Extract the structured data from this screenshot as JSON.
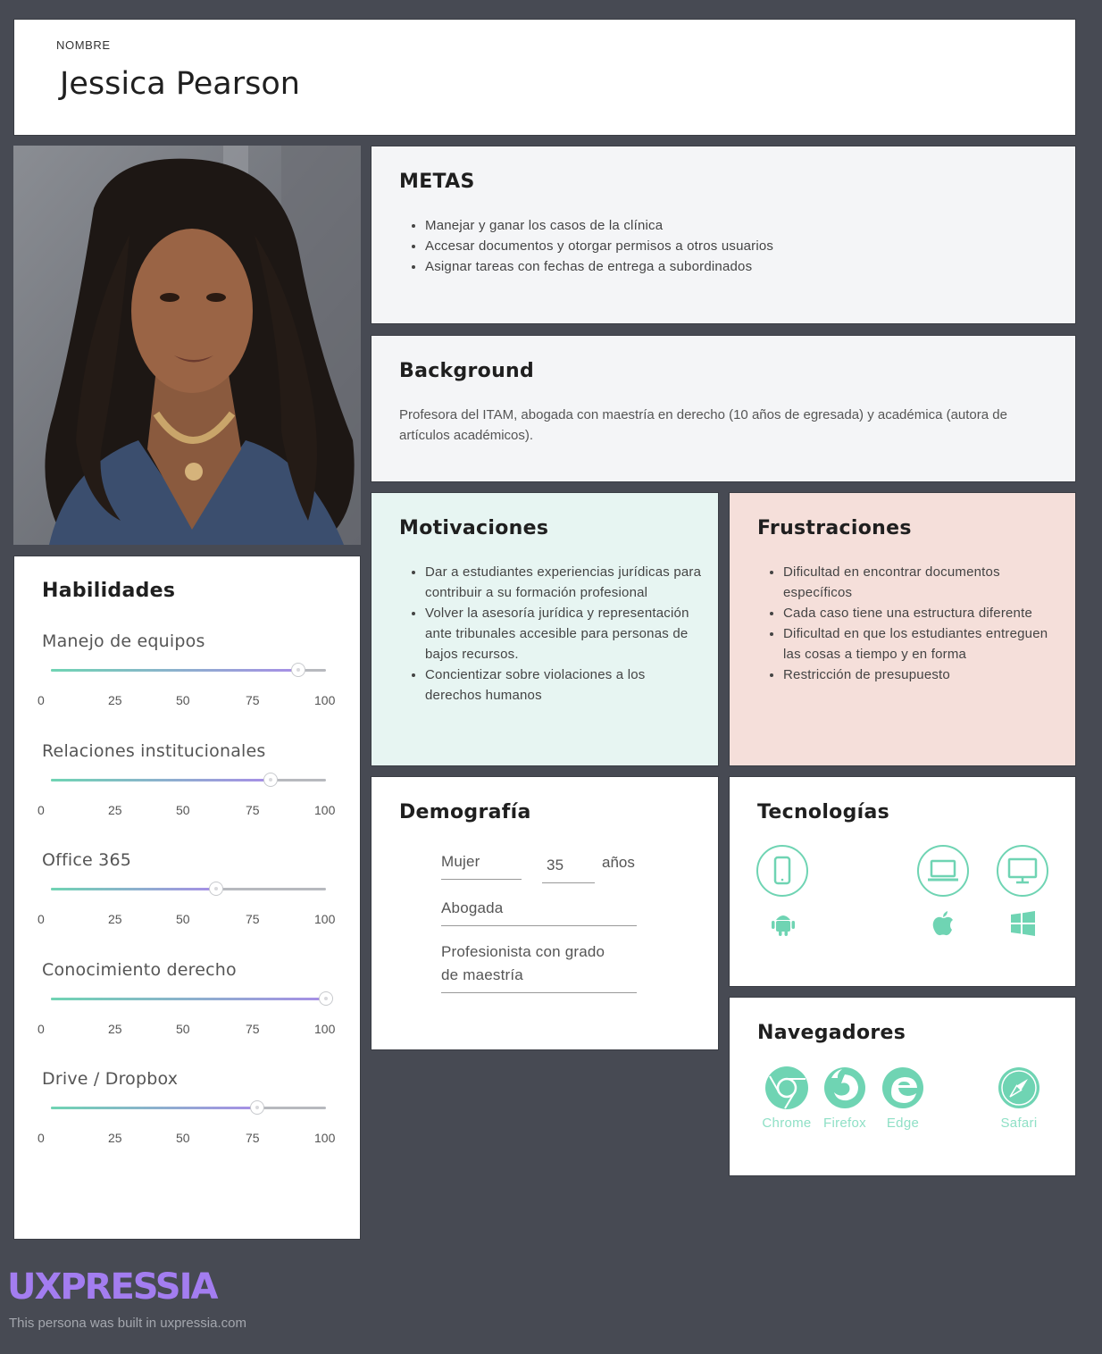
{
  "persona": {
    "name_label": "NOMBRE",
    "name": "Jessica Pearson"
  },
  "metas": {
    "title": "METAS",
    "items": [
      "Manejar y ganar los casos de la clínica",
      "Accesar documentos y otorgar permisos a otros usuarios",
      "Asignar tareas con fechas de entrega a subordinados"
    ]
  },
  "background": {
    "title": "Background",
    "text": "Profesora del ITAM,  abogada con maestría en derecho (10 años de egresada) y académica (autora de artículos académicos)."
  },
  "motivaciones": {
    "title": "Motivaciones",
    "items": [
      "Dar a estudiantes experiencias jurídicas para contribuir a su formación profesional",
      "Volver la asesoría jurídica y representación ante tribunales accesible para personas de bajos recursos.",
      "Concientizar sobre violaciones a los derechos humanos"
    ]
  },
  "frustraciones": {
    "title": "Frustraciones",
    "items": [
      "Dificultad en encontrar documentos específicos",
      "Cada caso tiene una estructura diferente",
      "Dificultad en que los estudiantes entreguen las cosas a tiempo y en forma",
      "Restricción de presupuesto"
    ]
  },
  "habilidades": {
    "title": "Habilidades",
    "ticks": [
      "0",
      "25",
      "50",
      "75",
      "100"
    ],
    "items": [
      {
        "label": "Manejo de equipos",
        "value": 90
      },
      {
        "label": "Relaciones institucionales",
        "value": 80
      },
      {
        "label": "Office 365",
        "value": 60
      },
      {
        "label": "Conocimiento derecho",
        "value": 100
      },
      {
        "label": "Drive / Dropbox",
        "value": 75
      }
    ]
  },
  "demografia": {
    "title": "Demografía",
    "gender": "Mujer",
    "age": "35",
    "age_unit": "años",
    "occupation": "Abogada",
    "education_line1": "Profesionista con grado",
    "education_line2": "de maestría"
  },
  "tecnologias": {
    "title": "Tecnologías",
    "devices": [
      "smartphone-icon",
      "laptop-icon",
      "desktop-icon"
    ],
    "os": [
      "android-icon",
      "apple-icon",
      "windows-icon"
    ],
    "accent": "#6fd4b3"
  },
  "navegadores": {
    "title": "Navegadores",
    "items": [
      "Chrome",
      "Firefox",
      "Edge",
      "Safari"
    ]
  },
  "footer": {
    "brand": "UXPRESSIA",
    "built": "This persona was built in uxpressia.com"
  },
  "colors": {
    "page_bg": "#474a53",
    "accent": "#6fd4b3",
    "brand": "#a37df0",
    "motivaciones_bg": "#e7f5f2",
    "frustraciones_bg": "#f5dfda"
  }
}
